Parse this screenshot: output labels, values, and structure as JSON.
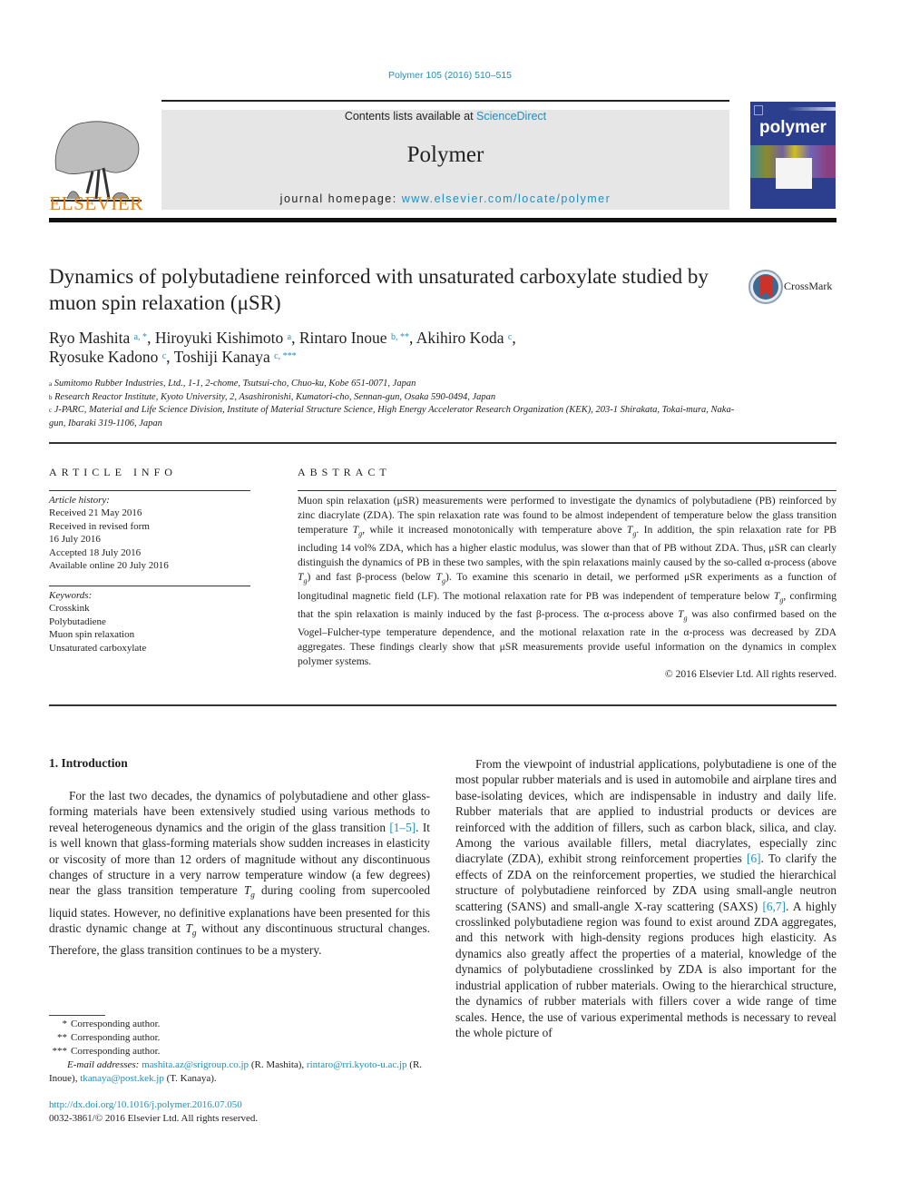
{
  "header": {
    "citation": "Polymer 105 (2016) 510–515",
    "contents_prefix": "Contents lists available at ",
    "contents_link": "ScienceDirect",
    "journal_name": "Polymer",
    "homepage_prefix": "journal homepage: ",
    "homepage_link": "www.elsevier.com/locate/polymer",
    "publisher_logo_text": "ELSEVIER",
    "cover_title": "polymer",
    "crossmark_label": "CrossMark"
  },
  "colors": {
    "link": "#1d8fc1",
    "elsevier_orange": "#ef7c00",
    "cover_blue": "#2c3f8f",
    "masthead_gray": "#e6e6e6"
  },
  "article": {
    "title": "Dynamics of polybutadiene reinforced with unsaturated carboxylate studied by muon spin relaxation (μSR)",
    "authors": [
      {
        "name": "Ryo Mashita",
        "marks": "a, *",
        "sep": ", "
      },
      {
        "name": "Hiroyuki Kishimoto",
        "marks": "a",
        "sep": ", "
      },
      {
        "name": "Rintaro Inoue",
        "marks": "b, **",
        "sep": ", "
      },
      {
        "name": "Akihiro Koda",
        "marks": "c",
        "sep": ","
      },
      {
        "name": "Ryosuke Kadono",
        "marks": "c",
        "sep": ", "
      },
      {
        "name": "Toshiji Kanaya",
        "marks": "c, ***",
        "sep": ""
      }
    ],
    "affiliations": [
      {
        "mark": "a",
        "text": "Sumitomo Rubber Industries, Ltd., 1-1, 2-chome, Tsutsui-cho, Chuo-ku, Kobe 651-0071, Japan"
      },
      {
        "mark": "b",
        "text": "Research Reactor Institute, Kyoto University, 2, Asashironishi, Kumatori-cho, Sennan-gun, Osaka 590-0494, Japan"
      },
      {
        "mark": "c",
        "text": "J-PARC, Material and Life Science Division, Institute of Material Structure Science, High Energy Accelerator Research Organization (KEK), 203-1 Shirakata, Tokai-mura, Naka-gun, Ibaraki 319-1106, Japan"
      }
    ]
  },
  "article_info": {
    "heading": "ARTICLE INFO",
    "history_label": "Article history:",
    "history": [
      "Received 21 May 2016",
      "Received in revised form",
      "16 July 2016",
      "Accepted 18 July 2016",
      "Available online 20 July 2016"
    ],
    "keywords_label": "Keywords:",
    "keywords": [
      "Crosskink",
      "Polybutadiene",
      "Muon spin relaxation",
      "Unsaturated carboxylate"
    ]
  },
  "abstract": {
    "heading": "ABSTRACT",
    "segments": [
      "Muon spin relaxation (μSR) measurements were performed to investigate the dynamics of polybutadiene (PB) reinforced by zinc diacrylate (ZDA). The spin relaxation rate was found to be almost independent of temperature below the glass transition temperature ",
      ", while it increased monotonically with temperature above ",
      ". In addition, the spin relaxation rate for PB including 14 vol% ZDA, which has a higher elastic modulus, was slower than that of PB without ZDA. Thus, μSR can clearly distinguish the dynamics of PB in these two samples, with the spin relaxations mainly caused by the so-called α-process (above ",
      ") and fast β-process (below ",
      "). To examine this scenario in detail, we performed μSR experiments as a function of longitudinal magnetic field (LF). The motional relaxation rate for PB was independent of temperature below ",
      ", confirming that the spin relaxation is mainly induced by the fast β-process. The α-process above ",
      " was also confirmed based on the Vogel–Fulcher-type temperature dependence, and the motional relaxation rate in the α-process was decreased by ZDA aggregates. These findings clearly show that μSR measurements provide useful information on the dynamics in complex polymer systems."
    ],
    "tg_symbol": "T",
    "tg_sub": "g",
    "copyright": "© 2016 Elsevier Ltd. All rights reserved."
  },
  "body": {
    "section_heading": "1.  Introduction",
    "left_paragraph": {
      "p1": "For the last two decades, the dynamics of polybutadiene and other glass-forming materials have been extensively studied using various methods to reveal heterogeneous dynamics and the origin of the glass transition ",
      "ref1": "[1–5]",
      "p2": ". It is well known that glass-forming materials show sudden increases in elasticity or viscosity of more than 12 orders of magnitude without any discontinuous changes of structure in a very narrow temperature window (a few degrees) near the glass transition temperature ",
      "p3": " during cooling from supercooled liquid states. However, no definitive explanations have been presented for this drastic dynamic change at ",
      "p4": " without any discontinuous structural changes. Therefore, the glass transition continues to be a mystery."
    },
    "right_paragraph": {
      "p1": "From the viewpoint of industrial applications, polybutadiene is one of the most popular rubber materials and is used in automobile and airplane tires and base-isolating devices, which are indispensable in industry and daily life. Rubber materials that are applied to industrial products or devices are reinforced with the addition of fillers, such as carbon black, silica, and clay. Among the various available fillers, metal diacrylates, especially zinc diacrylate (ZDA), exhibit strong reinforcement properties ",
      "ref1": "[6]",
      "p2": ". To clarify the effects of ZDA on the reinforcement properties, we studied the hierarchical structure of polybutadiene reinforced by ZDA using small-angle neutron scattering (SANS) and small-angle X-ray scattering (SAXS) ",
      "ref2": "[6,7]",
      "p3": ". A highly crosslinked polybutadiene region was found to exist around ZDA aggregates, and this network with high-density regions produces high elasticity. As dynamics also greatly affect the properties of a material, knowledge of the dynamics of polybutadiene crosslinked by ZDA is also important for the industrial application of rubber materials. Owing to the hierarchical structure, the dynamics of rubber materials with fillers cover a wide range of time scales. Hence, the use of various experimental methods is necessary to reveal the whole picture of"
    }
  },
  "footnotes": {
    "corresponding": [
      {
        "mark": "*",
        "text": "Corresponding author."
      },
      {
        "mark": "**",
        "text": "Corresponding author."
      },
      {
        "mark": "***",
        "text": "Corresponding author."
      }
    ],
    "email_label": "E-mail addresses:",
    "emails": [
      {
        "address": "mashita.az@srigroup.co.jp",
        "owner": "(R. Mashita), "
      },
      {
        "address": "rintaro@rri.kyoto-u.ac.jp",
        "owner": "(R. Inoue), "
      },
      {
        "address": "tkanaya@post.kek.jp",
        "owner": "(T. Kanaya)."
      }
    ],
    "doi": "http://dx.doi.org/10.1016/j.polymer.2016.07.050",
    "issn": "0032-3861/© 2016 Elsevier Ltd. All rights reserved."
  }
}
